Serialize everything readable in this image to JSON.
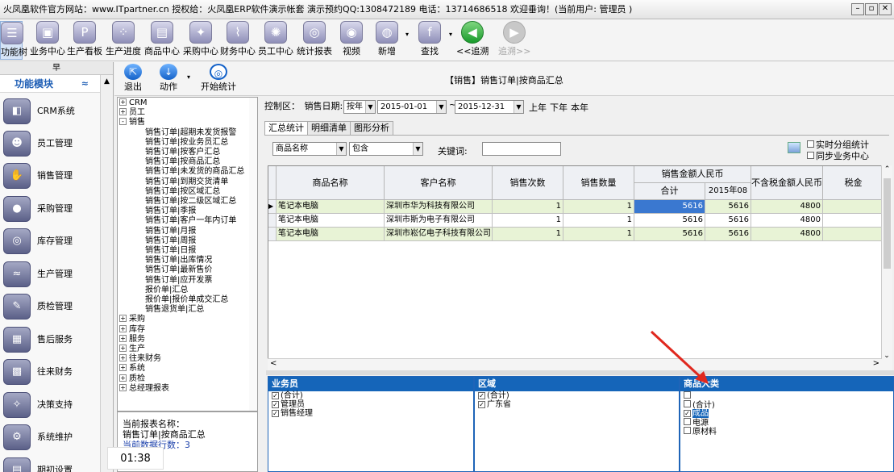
{
  "title": "火凤凰软件官方网站：www.ITpartner.cn 授权给：火凤凰ERP软件演示帐套 演示预约QQ:1308472189 电话：13714686518 欢迎垂询！(当前用户: 管理员 )",
  "window_buttons": [
    "–",
    "▫",
    "✕"
  ],
  "toolbar": [
    {
      "label": "功能树",
      "icon": "tree-icon"
    },
    {
      "label": "业务中心",
      "icon": "business-icon"
    },
    {
      "label": "生产看板",
      "icon": "p-icon"
    },
    {
      "label": "生产进度",
      "icon": "progress-icon"
    },
    {
      "label": "商品中心",
      "icon": "product-icon"
    },
    {
      "label": "采购中心",
      "icon": "purchase-icon"
    },
    {
      "label": "财务中心",
      "icon": "finance-icon"
    },
    {
      "label": "员工中心",
      "icon": "staff-icon"
    },
    {
      "label": "统计报表",
      "icon": "report-icon"
    },
    {
      "label": "视频",
      "icon": "video-icon"
    },
    {
      "label": "新增",
      "icon": "add-icon"
    },
    {
      "label": "查找",
      "icon": "find-icon"
    },
    {
      "label": "<<追溯",
      "icon": "back-icon"
    },
    {
      "label": "追溯>>",
      "icon": "forward-icon"
    }
  ],
  "left_panel": {
    "header": "早",
    "title": "功能模块",
    "modules": [
      "CRM系统",
      "员工管理",
      "销售管理",
      "采购管理",
      "库存管理",
      "生产管理",
      "质检管理",
      "售后服务",
      "往来财务",
      "决策支持",
      "系统维护",
      "期初设置"
    ]
  },
  "clock": "01:38",
  "subtoolbar": {
    "exit": "退出",
    "action": "动作",
    "start_stats": "开始统计",
    "report_title": "【销售】销售订单|按商品汇总"
  },
  "tree": {
    "top": [
      {
        "label": "CRM",
        "sign": "+"
      },
      {
        "label": "员工",
        "sign": "+"
      },
      {
        "label": "销售",
        "sign": "-"
      }
    ],
    "sales_children": [
      "销售订单|超期未发货报警",
      "销售订单|按业务员汇总",
      "销售订单|按客户汇总",
      "销售订单|按商品汇总",
      "销售订单|未发货的商品汇总",
      "销售订单|到期交货清单",
      "销售订单|按区域汇总",
      "销售订单|按二级区域汇总",
      "销售订单|季报",
      "销售订单|客户一年内订单",
      "销售订单|月报",
      "销售订单|周报",
      "销售订单|日报",
      "销售订单|出库情况",
      "销售订单|最新售价",
      "销售订单|应开发票",
      "报价单|汇总",
      "报价单|报价单成交汇总",
      "销售退货单|汇总"
    ],
    "bottom": [
      "采购",
      "库存",
      "服务",
      "生产",
      "往来财务",
      "系统",
      "质检",
      "总经理报表"
    ]
  },
  "info": {
    "line1": "当前报表名称：",
    "line2": "销售订单|按商品汇总",
    "line3": "当前数据行数：3"
  },
  "control": {
    "label": "控制区：",
    "date_label": "销售日期:",
    "period": "按年",
    "start": "2015-01-01",
    "tilde": "~",
    "end": "2015-12-31",
    "shortcuts": [
      "上年",
      "下年",
      "本年"
    ]
  },
  "tabs": [
    "汇总统计",
    "明细清单",
    "图形分析"
  ],
  "filter": {
    "field": "商品名称",
    "op": "包含",
    "keyword_label": "关键词:",
    "keyword": "",
    "opt1": "实时分组统计",
    "opt2": "同步业务中心"
  },
  "grid": {
    "headers": [
      "商品名称",
      "客户名称",
      "销售次数",
      "销售数量",
      "销售金额人民币",
      "合计",
      "2015年08月",
      "不含税金额人民币",
      "税金"
    ],
    "rows": [
      {
        "name": "笔记本电脑",
        "customer": "深圳市华为科技有限公司",
        "times": "1",
        "qty": "1",
        "total": "5616",
        "aug": "5616",
        "notax": "4800"
      },
      {
        "name": "笔记本电脑",
        "customer": "深圳市斯为电子有限公司",
        "times": "1",
        "qty": "1",
        "total": "5616",
        "aug": "5616",
        "notax": "4800"
      },
      {
        "name": "笔记本电脑",
        "customer": "深圳市崧亿电子科技有限公司",
        "times": "1",
        "qty": "1",
        "total": "5616",
        "aug": "5616",
        "notax": "4800"
      }
    ]
  },
  "panels": {
    "salesman": {
      "title": "业务员",
      "items": [
        {
          "label": "(合计)",
          "checked": true
        },
        {
          "label": "管理员",
          "checked": true
        },
        {
          "label": "销售经理",
          "checked": true
        }
      ]
    },
    "region": {
      "title": "区域",
      "items": [
        {
          "label": "(合计)",
          "checked": true
        },
        {
          "label": "广东省",
          "checked": true
        }
      ]
    },
    "category": {
      "title": "商品大类",
      "items": [
        {
          "label": "",
          "checked": false
        },
        {
          "label": "(合计)",
          "checked": false
        },
        {
          "label": "成品",
          "checked": true
        },
        {
          "label": "电源",
          "checked": false
        },
        {
          "label": "原材料",
          "checked": false
        }
      ]
    }
  },
  "colors": {
    "accent": "#1565b9",
    "row_green": "#e8f3d6",
    "arrow": "#e0281e"
  }
}
